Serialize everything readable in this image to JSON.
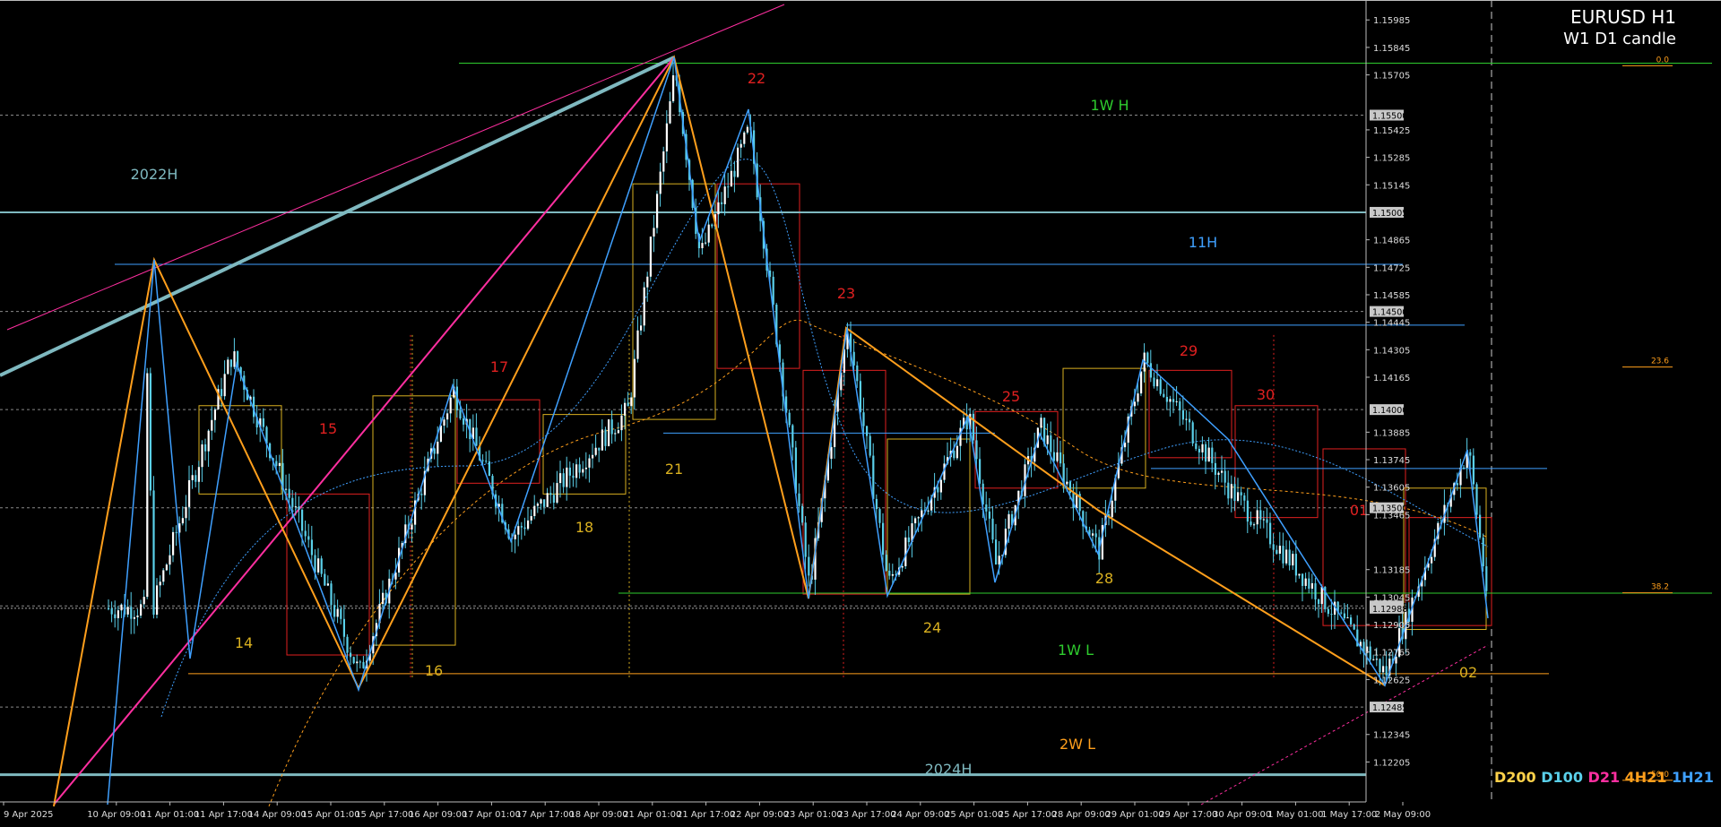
{
  "window": {
    "symbol_label": "EURUSD H1",
    "candle_mode_label": "W1 D1 candle"
  },
  "colors": {
    "background": "#000000",
    "candle_bull": "#ffffff",
    "candle_bear": "#5ad0ea",
    "wick": "#5ad0ea",
    "grid_dotted": "#8a8a8a",
    "zigzag_orange": "#ff9f1c",
    "zigzag_blue": "#3fa0ff",
    "daily_box_red": "#e02020",
    "daily_box_yellow": "#d9b020",
    "trend_magenta": "#ff2fa0",
    "teal_line": "#7fb9c0",
    "green_line": "#2ecc2e"
  },
  "price_axis": {
    "labels": [
      {
        "price": 1.15985,
        "text": "1.15985"
      },
      {
        "price": 1.15845,
        "text": "1.15845"
      },
      {
        "price": 1.15705,
        "text": "1.15705"
      },
      {
        "price": 1.15425,
        "text": "1.15425"
      },
      {
        "price": 1.15285,
        "text": "1.15285"
      },
      {
        "price": 1.15145,
        "text": "1.15145"
      },
      {
        "price": 1.14865,
        "text": "1.14865"
      },
      {
        "price": 1.14725,
        "text": "1.14725"
      },
      {
        "price": 1.14585,
        "text": "1.14585"
      },
      {
        "price": 1.14445,
        "text": "1.14445"
      },
      {
        "price": 1.14305,
        "text": "1.14305"
      },
      {
        "price": 1.14165,
        "text": "1.14165"
      },
      {
        "price": 1.13885,
        "text": "1.13885"
      },
      {
        "price": 1.13745,
        "text": "1.13745"
      },
      {
        "price": 1.13605,
        "text": "1.13605"
      },
      {
        "price": 1.13465,
        "text": "1.13465"
      },
      {
        "price": 1.13185,
        "text": "1.13185"
      },
      {
        "price": 1.13045,
        "text": "1.13045"
      },
      {
        "price": 1.12905,
        "text": "1.12905"
      },
      {
        "price": 1.12765,
        "text": "1.12765"
      },
      {
        "price": 1.12625,
        "text": "1.12625"
      },
      {
        "price": 1.12345,
        "text": "1.12345"
      },
      {
        "price": 1.12205,
        "text": "1.12205"
      }
    ],
    "highlighted_labels": [
      {
        "price": 1.155,
        "text": "1.15500"
      },
      {
        "price": 1.15005,
        "text": "1.15005"
      },
      {
        "price": 1.145,
        "text": "1.14500"
      },
      {
        "price": 1.14,
        "text": "1.14000"
      },
      {
        "price": 1.135,
        "text": "1.13500"
      },
      {
        "price": 1.13,
        "text": "1.13000"
      },
      {
        "price": 1.12485,
        "text": "1.12485"
      }
    ],
    "current_price": {
      "price": 1.12988,
      "text": "1.12988"
    }
  },
  "time_axis": {
    "labels": [
      "9 Apr 2025",
      "10 Apr 09:00",
      "11 Apr 01:00",
      "11 Apr 17:00",
      "14 Apr 09:00",
      "15 Apr 01:00",
      "15 Apr 17:00",
      "16 Apr 09:00",
      "17 Apr 01:00",
      "17 Apr 17:00",
      "18 Apr 09:00",
      "21 Apr 01:00",
      "21 Apr 17:00",
      "22 Apr 09:00",
      "23 Apr 01:00",
      "23 Apr 17:00",
      "24 Apr 09:00",
      "25 Apr 01:00",
      "25 Apr 17:00",
      "28 Apr 09:00",
      "29 Apr 01:00",
      "29 Apr 17:00",
      "30 Apr 09:00",
      "1 May 01:00",
      "1 May 17:00",
      "2 May 09:00"
    ]
  },
  "annotations": {
    "level_labels": [
      {
        "text": "2022H",
        "color": "#7fb9c0"
      },
      {
        "text": "1W H",
        "color": "#2ecc2e"
      },
      {
        "text": "11H",
        "color": "#3fa0ff"
      },
      {
        "text": "1W L",
        "color": "#2ecc2e"
      },
      {
        "text": "2W L",
        "color": "#ff9f1c"
      },
      {
        "text": "2024H",
        "color": "#7fb9c0"
      }
    ],
    "day_labels": [
      {
        "text": "14",
        "color": "#d9b020"
      },
      {
        "text": "15",
        "color": "#e02020"
      },
      {
        "text": "16",
        "color": "#d9b020"
      },
      {
        "text": "17",
        "color": "#e02020"
      },
      {
        "text": "18",
        "color": "#d9b020"
      },
      {
        "text": "21",
        "color": "#d9b020"
      },
      {
        "text": "22",
        "color": "#e02020"
      },
      {
        "text": "23",
        "color": "#e02020"
      },
      {
        "text": "24",
        "color": "#d9b020"
      },
      {
        "text": "25",
        "color": "#e02020"
      },
      {
        "text": "28",
        "color": "#d9b020"
      },
      {
        "text": "29",
        "color": "#e02020"
      },
      {
        "text": "30",
        "color": "#e02020"
      },
      {
        "text": "01",
        "color": "#e02020"
      },
      {
        "text": "02",
        "color": "#d9b020"
      }
    ],
    "fib_labels": [
      {
        "text": "0.0",
        "price": 1.1577
      },
      {
        "text": "23.6",
        "price": 1.14235
      },
      {
        "text": "38.2",
        "price": 1.13085
      },
      {
        "text": "50.0",
        "price": 1.1213
      }
    ]
  },
  "ma_legend": [
    {
      "text": "D200",
      "color": "#ffd24a"
    },
    {
      "text": "D100",
      "color": "#5ad0ea"
    },
    {
      "text": "D21",
      "color": "#ff2fa0"
    },
    {
      "text": "4H21",
      "color": "#ff9f1c"
    },
    {
      "text": "1H21",
      "color": "#3fa0ff"
    }
  ],
  "chart_data": {
    "type": "candlestick",
    "symbol": "EURUSD",
    "timeframe": "H1",
    "ylim": [
      1.1207,
      1.1605
    ],
    "horizontal_levels": [
      {
        "label": "2022H",
        "price": 1.15005,
        "color": "#7fb9c0"
      },
      {
        "label": "1W H",
        "price": 1.15765,
        "color": "#2ecc2e"
      },
      {
        "label": "11H",
        "price": 1.1474,
        "color": "#3fa0ff"
      },
      {
        "label": "1W L",
        "price": 1.13065,
        "color": "#2ecc2e"
      },
      {
        "label": "2W L",
        "price": 1.12655,
        "color": "#ff9f1c"
      },
      {
        "label": "2024H",
        "price": 1.1214,
        "color": "#7fb9c0"
      }
    ],
    "zigzag_pivots": [
      {
        "time": "11 Apr 01:00",
        "price": 1.14735
      },
      {
        "time": "14 Apr 09:00",
        "price": 1.14285
      },
      {
        "time": "15 Apr 17:00",
        "price": 1.12655
      },
      {
        "time": "16 Apr 09:00",
        "price": 1.141
      },
      {
        "time": "17 Apr 01:00",
        "price": 1.1335
      },
      {
        "time": "21 Apr 01:00",
        "price": 1.15735
      },
      {
        "time": "21 Apr 17:00",
        "price": 1.1478
      },
      {
        "time": "22 Apr 09:00",
        "price": 1.1543
      },
      {
        "time": "23 Apr 01:00",
        "price": 1.13095
      },
      {
        "time": "23 Apr 09:00",
        "price": 1.1443
      },
      {
        "time": "23 Apr 17:00",
        "price": 1.1311
      },
      {
        "time": "24 Apr 09:00",
        "price": 1.1397
      },
      {
        "time": "25 Apr 01:00",
        "price": 1.1321
      },
      {
        "time": "25 Apr 09:00",
        "price": 1.1391
      },
      {
        "time": "28 Apr 09:00",
        "price": 1.1328
      },
      {
        "time": "29 Apr 01:00",
        "price": 1.14255
      },
      {
        "time": "1 May 17:00",
        "price": 1.12655
      },
      {
        "time": "2 May 09:00",
        "price": 1.1381
      },
      {
        "time": "2 May 13:00",
        "price": 1.12988
      }
    ]
  }
}
